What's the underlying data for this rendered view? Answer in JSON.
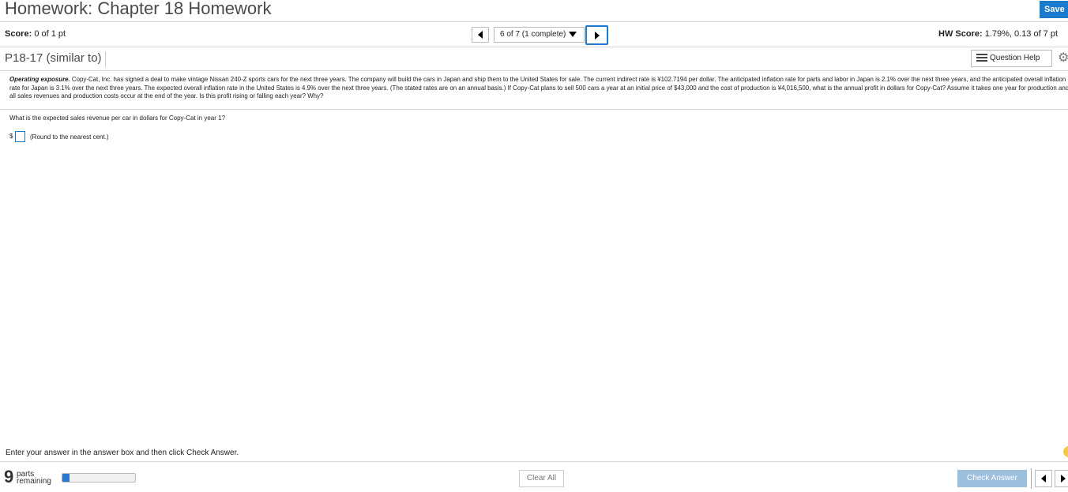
{
  "header": {
    "title": "Homework: Chapter 18 Homework",
    "save_label": "Save"
  },
  "score": {
    "label": "Score:",
    "value": "0 of 1 pt",
    "hw_label": "HW Score:",
    "hw_value": "1.79%, 0.13 of 7 pt"
  },
  "nav": {
    "selected": "6 of 7 (1 complete)"
  },
  "question": {
    "id": "P18-17 (similar to)",
    "help_label": "Question Help",
    "heading": "Operating exposure.",
    "body": " Copy-Cat, Inc. has signed a deal to make vintage Nissan 240-Z sports cars for the next three years.  The company will build the cars in Japan and ship them to the United States for sale.  The current indirect rate is ¥102.7194 per dollar.   The anticipated inflation rate for parts and labor in Japan is 2.1% over the next three years, and the anticipated overall inflation rate for Japan is 3.1% over the next three years.  The expected overall inflation rate in the United States is 4.9% over the next three years.  (The stated rates are on an annual basis.)  If Copy-Cat plans to sell 500 cars a year at an initial price of $43,000 and the cost of production is ¥4,016,500, what is the annual profit in dollars for Copy-Cat?  Assume it takes one year for production and all sales revenues and production costs occur at the end of the year.  Is this profit rising or falling each year?  Why?",
    "part_prompt": "What is the expected sales revenue per car in dollars for Copy-Cat in year 1?",
    "currency": "$",
    "answer_value": "",
    "round_note": "(Round to the nearest cent.)"
  },
  "footer": {
    "instruction": "Enter your answer in the answer box and then click Check Answer.",
    "parts_count": "9",
    "parts_word": "parts",
    "remaining_word": "remaining",
    "progress_fraction": 0.1,
    "clear_label": "Clear All",
    "check_label": "Check Answer"
  }
}
